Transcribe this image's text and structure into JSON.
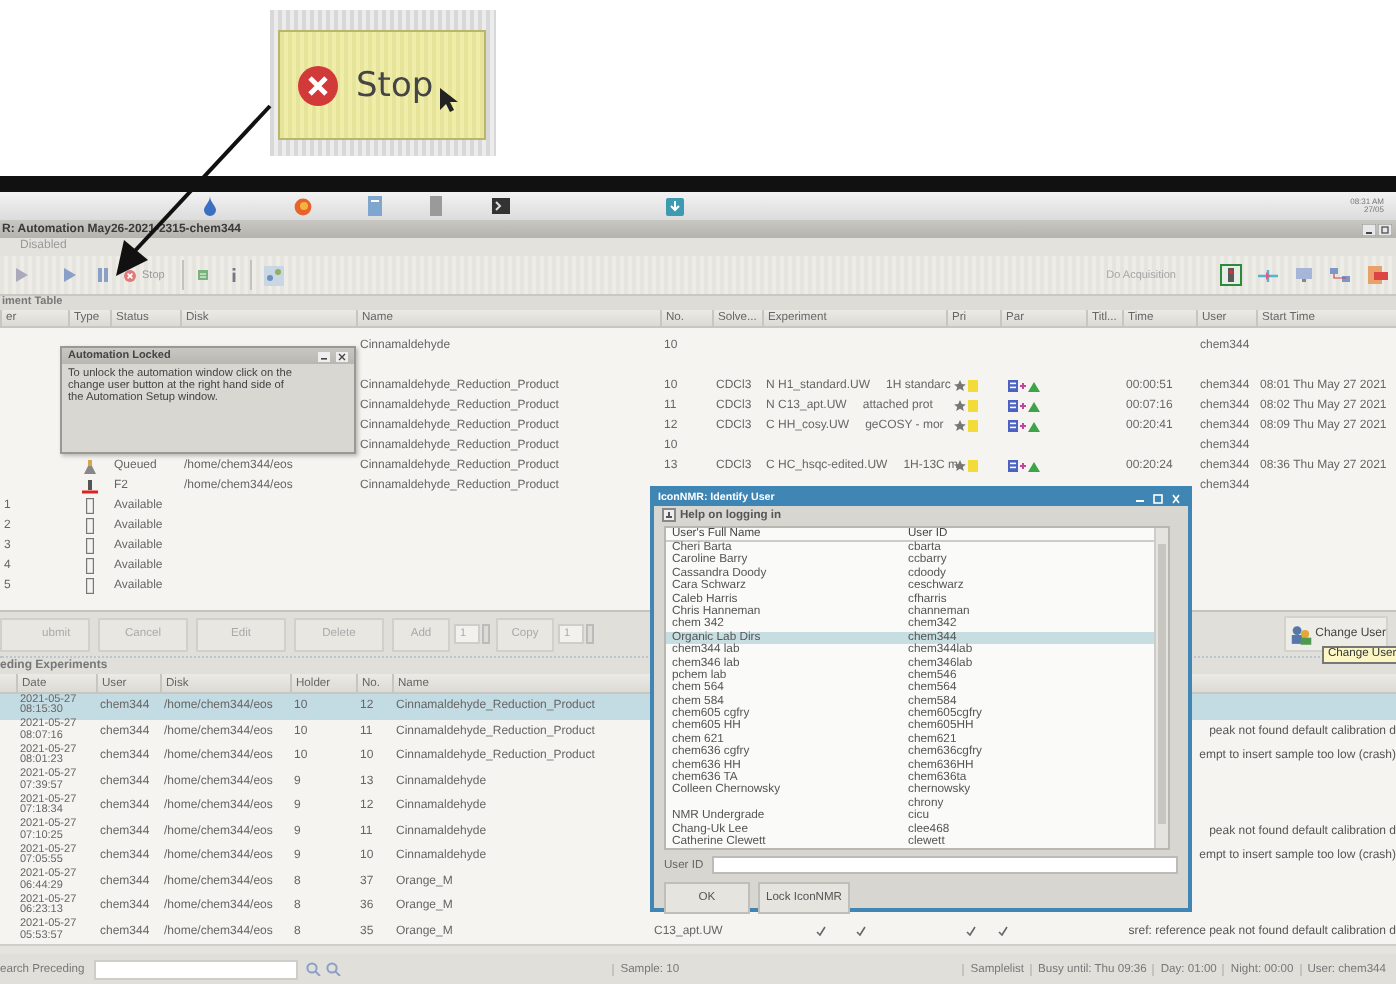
{
  "callout": {
    "label": "Stop"
  },
  "taskbar": {
    "clock_time": "08:31 AM",
    "clock_date": "27/05"
  },
  "window": {
    "title": "R: Automation May26-2021-2315-chem344",
    "mode": "Disabled"
  },
  "toolbar": {
    "stop_label": "Stop",
    "acquisition": "Do Acquisition"
  },
  "experiment_table": {
    "title": "iment Table",
    "columns": [
      "er",
      "Type",
      "Status",
      "Disk",
      "Name",
      "No.",
      "Solve...",
      "Experiment",
      "Pri",
      "Par",
      "Titl...",
      "Time",
      "User",
      "Start Time"
    ],
    "rows": [
      {
        "kind": "sample",
        "name": "Cinnamaldehyde",
        "no": "10",
        "user": "chem344"
      },
      {
        "kind": "blank"
      },
      {
        "kind": "experiment",
        "name": "Cinnamaldehyde_Reduction_Product",
        "no": "10",
        "solvent": "CDCl3",
        "experiment": "N H1_standard.UW",
        "description": "1H standarc",
        "time": "00:00:51",
        "user": "chem344",
        "start_time": "08:01 Thu May 27 2021"
      },
      {
        "kind": "experiment",
        "name": "Cinnamaldehyde_Reduction_Product",
        "no": "11",
        "solvent": "CDCl3",
        "experiment": "N C13_apt.UW",
        "description": "attached prot",
        "time": "00:07:16",
        "user": "chem344",
        "start_time": "08:02 Thu May 27 2021"
      },
      {
        "kind": "experiment",
        "name": "Cinnamaldehyde_Reduction_Product",
        "no": "12",
        "solvent": "CDCl3",
        "experiment": "C HH_cosy.UW",
        "description": "geCOSY - mor",
        "time": "00:20:41",
        "user": "chem344",
        "start_time": "08:09 Thu May 27 2021"
      },
      {
        "kind": "sample",
        "name": "Cinnamaldehyde_Reduction_Product",
        "no": "10",
        "user": "chem344"
      },
      {
        "kind": "queued",
        "status": "Queued",
        "disk": "/home/chem344/eos",
        "name": "Cinnamaldehyde_Reduction_Product",
        "no": "13",
        "solvent": "CDCl3",
        "experiment": "C HC_hsqc-edited.UW",
        "description": "1H-13C m",
        "time": "00:20:24",
        "user": "chem344",
        "start_time": "08:36 Thu May 27 2021"
      },
      {
        "kind": "spinning",
        "status": "F2",
        "disk": "/home/chem344/eos",
        "name": "Cinnamaldehyde_Reduction_Product",
        "user": "chem344"
      },
      {
        "kind": "available",
        "holder": "1",
        "status": "Available"
      },
      {
        "kind": "available",
        "holder": "2",
        "status": "Available"
      },
      {
        "kind": "available",
        "holder": "3",
        "status": "Available"
      },
      {
        "kind": "available",
        "holder": "4",
        "status": "Available"
      },
      {
        "kind": "available",
        "holder": "5",
        "status": "Available"
      }
    ]
  },
  "automation_locked": {
    "title": "Automation Locked",
    "message": "To unlock the automation window click on the change user button at the right hand side of the Automation Setup window."
  },
  "button_bar": {
    "buttons": [
      "ubmit",
      "Cancel",
      "Edit",
      "Delete"
    ],
    "spinners": [
      {
        "label": "Add",
        "value": "1"
      },
      {
        "label": "Copy",
        "value": "1"
      }
    ],
    "change_user": "Change User",
    "tooltip": "Change User"
  },
  "preceding": {
    "title": "eding Experiments",
    "columns": [
      "Date",
      "User",
      "Disk",
      "Holder",
      "No.",
      "Name"
    ],
    "rows": [
      {
        "selected": true,
        "date": "2021-05-27",
        "time": "08:15:30",
        "user": "chem344",
        "disk": "/home/chem344/eos",
        "holder": "10",
        "no": "12",
        "name": "Cinnamaldehyde_Reduction_Product"
      },
      {
        "selected": false,
        "date": "2021-05-27",
        "time": "08:07:16",
        "user": "chem344",
        "disk": "/home/chem344/eos",
        "holder": "10",
        "no": "11",
        "name": "Cinnamaldehyde_Reduction_Product",
        "comment": "peak not found default calibration d"
      },
      {
        "selected": false,
        "date": "2021-05-27",
        "time": "08:01:23",
        "user": "chem344",
        "disk": "/home/chem344/eos",
        "holder": "10",
        "no": "10",
        "name": "Cinnamaldehyde_Reduction_Product",
        "comment": "empt to insert sample too low (crash)"
      },
      {
        "selected": false,
        "date": "2021-05-27",
        "time": "07:39:57",
        "user": "chem344",
        "disk": "/home/chem344/eos",
        "holder": "9",
        "no": "13",
        "name": "Cinnamaldehyde"
      },
      {
        "selected": false,
        "date": "2021-05-27",
        "time": "07:18:34",
        "user": "chem344",
        "disk": "/home/chem344/eos",
        "holder": "9",
        "no": "12",
        "name": "Cinnamaldehyde"
      },
      {
        "selected": false,
        "date": "2021-05-27",
        "time": "07:10:25",
        "user": "chem344",
        "disk": "/home/chem344/eos",
        "holder": "9",
        "no": "11",
        "name": "Cinnamaldehyde",
        "comment": "peak not found default calibration d"
      },
      {
        "selected": false,
        "date": "2021-05-27",
        "time": "07:05:55",
        "user": "chem344",
        "disk": "/home/chem344/eos",
        "holder": "9",
        "no": "10",
        "name": "Cinnamaldehyde",
        "comment": "empt to insert sample too low (crash)"
      },
      {
        "selected": false,
        "date": "2021-05-27",
        "time": "06:44:29",
        "user": "chem344",
        "disk": "/home/chem344/eos",
        "holder": "8",
        "no": "37",
        "name": "Orange_M"
      },
      {
        "selected": false,
        "date": "2021-05-27",
        "time": "06:23:13",
        "user": "chem344",
        "disk": "/home/chem344/eos",
        "holder": "8",
        "no": "36",
        "name": "Orange_M"
      },
      {
        "selected": false,
        "date": "2021-05-27",
        "time": "05:53:57",
        "user": "chem344",
        "disk": "/home/chem344/eos",
        "holder": "8",
        "no": "35",
        "name": "Orange_M",
        "experiment": "C13_apt.UW",
        "flags": [
          true,
          true,
          true,
          true
        ],
        "comment": "sref: reference peak not found default calibration d"
      }
    ]
  },
  "identify_user": {
    "title": "IconNMR: Identify User",
    "help": "Help on logging in",
    "help_expanded": false,
    "columns": [
      "User's Full Name",
      "User ID"
    ],
    "users": [
      {
        "name": "Cheri Barta",
        "id": "cbarta",
        "selected": false
      },
      {
        "name": "Caroline Barry",
        "id": "ccbarry",
        "selected": false
      },
      {
        "name": "Cassandra Doody",
        "id": "cdoody",
        "selected": false
      },
      {
        "name": "Cara Schwarz",
        "id": "ceschwarz",
        "selected": false
      },
      {
        "name": "Caleb Harris",
        "id": "cfharris",
        "selected": false
      },
      {
        "name": "Chris Hanneman",
        "id": "channeman",
        "selected": false
      },
      {
        "name": "chem 342",
        "id": "chem342",
        "selected": false
      },
      {
        "name": "Organic Lab Dirs",
        "id": "chem344",
        "selected": true
      },
      {
        "name": "chem344 lab",
        "id": "chem344lab",
        "selected": false
      },
      {
        "name": "chem346 lab",
        "id": "chem346lab",
        "selected": false
      },
      {
        "name": "pchem lab",
        "id": "chem546",
        "selected": false
      },
      {
        "name": "chem 564",
        "id": "chem564",
        "selected": false
      },
      {
        "name": "chem 584",
        "id": "chem584",
        "selected": false
      },
      {
        "name": "chem605 cgfry",
        "id": "chem605cgfry",
        "selected": false
      },
      {
        "name": "chem605 HH",
        "id": "chem605HH",
        "selected": false
      },
      {
        "name": "chem 621",
        "id": "chem621",
        "selected": false
      },
      {
        "name": "chem636 cgfry",
        "id": "chem636cgfry",
        "selected": false
      },
      {
        "name": "chem636 HH",
        "id": "chem636HH",
        "selected": false
      },
      {
        "name": "chem636 TA",
        "id": "chem636ta",
        "selected": false
      },
      {
        "name": "Colleen Chernowsky",
        "id": "chernowsky",
        "selected": false
      },
      {
        "id": "chrony",
        "selected": false
      },
      {
        "name": "NMR Undergrade",
        "id": "cicu",
        "selected": false
      },
      {
        "name": "Chang-Uk Lee",
        "id": "clee468",
        "selected": false
      },
      {
        "name": "Catherine Clewett",
        "id": "clewett",
        "selected": false
      }
    ],
    "user_id_label": "User ID",
    "buttons": [
      "OK",
      "Lock IconNMR"
    ]
  },
  "status_bar": {
    "search_label": "earch Preceding",
    "sample": "Sample: 10",
    "segments": [
      "Samplelist",
      "Busy until:  Thu 09:36",
      "Day: 01:00",
      "Night: 00:00",
      "User: chem344"
    ]
  }
}
